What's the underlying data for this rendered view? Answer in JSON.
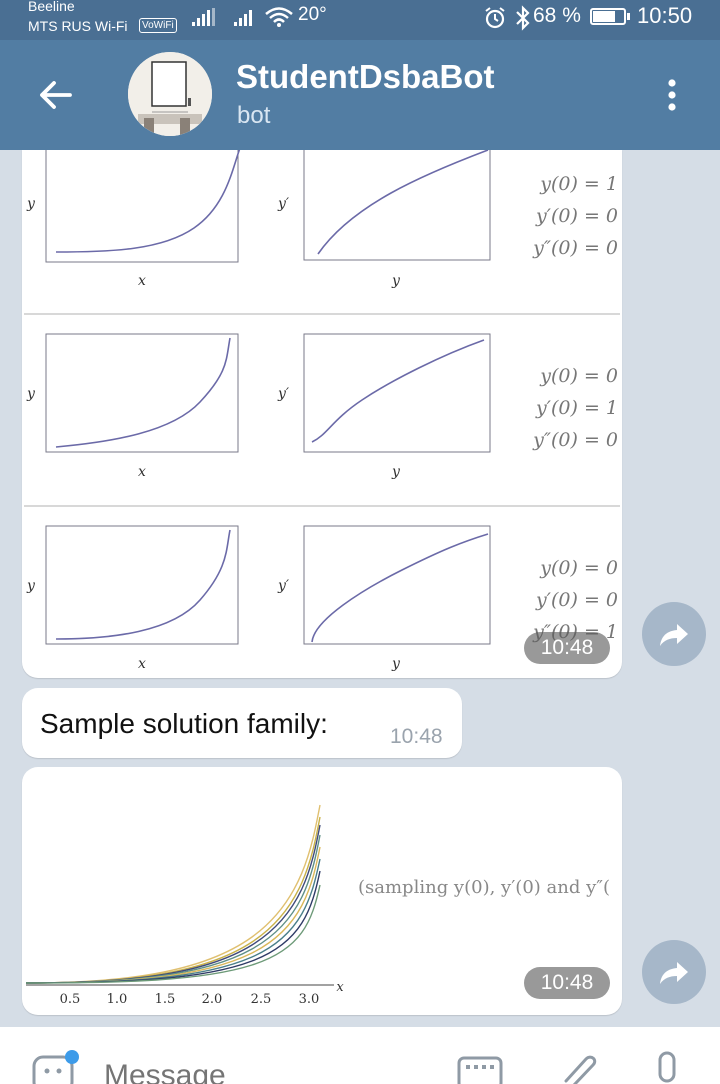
{
  "status_bar": {
    "carrier_primary": "Beeline",
    "carrier_secondary": "MTS RUS Wi-Fi",
    "vowifi_badge": "VoWiFi",
    "temperature": "20°",
    "battery_percent": "68 %",
    "battery_level": 0.68,
    "time": "10:50"
  },
  "header": {
    "title": "StudentDsbaBot",
    "subtitle": "bot"
  },
  "messages": [
    {
      "type": "image",
      "description_labels": {
        "x_axis": "x",
        "y_axis": "y",
        "y_prime_axis": "y′",
        "panels": [
          {
            "c1": "y(0) = 1",
            "c2": "y′(0) = 0",
            "c3": "y″(0) = 0"
          },
          {
            "c1": "y(0) = 0",
            "c2": "y′(0) = 1",
            "c3": "y″(0) = 0"
          },
          {
            "c1": "y(0) = 0",
            "c2": "y′(0) = 0",
            "c3": "y″(0) = 1"
          }
        ]
      },
      "time": "10:48"
    },
    {
      "type": "text",
      "text": "Sample solution family:",
      "time": "10:48"
    },
    {
      "type": "image",
      "caption": "(sampling y(0), y′(0) and y″(",
      "x_label": "x",
      "x_ticks": [
        "0.5",
        "1.0",
        "1.5",
        "2.0",
        "2.5",
        "3.0"
      ],
      "time": "10:48"
    }
  ],
  "composer": {
    "placeholder": "Message"
  },
  "colors": {
    "header": "#527da3",
    "status_bar": "#4a6f93",
    "curve": "#6b6aa8"
  }
}
